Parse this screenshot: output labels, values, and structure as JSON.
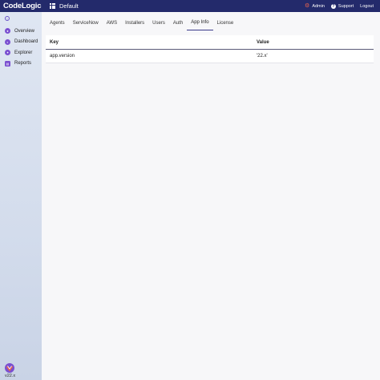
{
  "header": {
    "brand": "CodeLogic",
    "workspace": "Default",
    "admin_label": "Admin",
    "support_label": "Support",
    "logout_label": "Logout"
  },
  "sidebar": {
    "items": [
      {
        "label": "Overview",
        "icon": "overview-icon"
      },
      {
        "label": "Dashboard",
        "icon": "dashboard-icon"
      },
      {
        "label": "Explorer",
        "icon": "explorer-icon"
      },
      {
        "label": "Reports",
        "icon": "reports-icon"
      }
    ],
    "version": "v22.x"
  },
  "tabs": [
    {
      "label": "Agents"
    },
    {
      "label": "ServiceNow"
    },
    {
      "label": "AWS"
    },
    {
      "label": "Installers"
    },
    {
      "label": "Users"
    },
    {
      "label": "Auth"
    },
    {
      "label": "App Info",
      "active": true
    },
    {
      "label": "License"
    }
  ],
  "table": {
    "columns": [
      "Key",
      "Value"
    ],
    "rows": [
      {
        "key": "app.version",
        "value": "'22.x'"
      }
    ]
  },
  "colors": {
    "header_bg": "#232a6b",
    "accent": "#7a4fd0",
    "admin_icon": "#e8634d"
  }
}
